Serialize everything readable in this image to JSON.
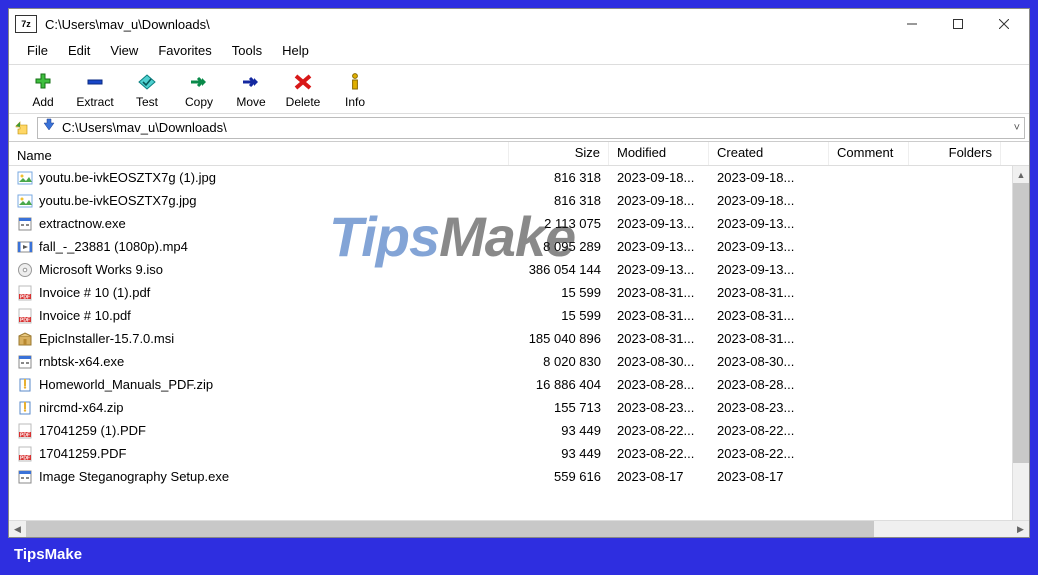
{
  "title": "C:\\Users\\mav_u\\Downloads\\",
  "app_icon_text": "7z",
  "menubar": [
    "File",
    "Edit",
    "View",
    "Favorites",
    "Tools",
    "Help"
  ],
  "toolbar": [
    {
      "id": "add",
      "label": "Add"
    },
    {
      "id": "extract",
      "label": "Extract"
    },
    {
      "id": "test",
      "label": "Test"
    },
    {
      "id": "copy",
      "label": "Copy"
    },
    {
      "id": "move",
      "label": "Move"
    },
    {
      "id": "delete",
      "label": "Delete"
    },
    {
      "id": "info",
      "label": "Info"
    }
  ],
  "path": "C:\\Users\\mav_u\\Downloads\\",
  "columns": {
    "name": "Name",
    "size": "Size",
    "modified": "Modified",
    "created": "Created",
    "comment": "Comment",
    "folders": "Folders"
  },
  "files": [
    {
      "icon": "img",
      "name": "youtu.be-ivkEOSZTX7g (1).jpg",
      "size": "816 318",
      "modified": "2023-09-18...",
      "created": "2023-09-18..."
    },
    {
      "icon": "img",
      "name": "youtu.be-ivkEOSZTX7g.jpg",
      "size": "816 318",
      "modified": "2023-09-18...",
      "created": "2023-09-18..."
    },
    {
      "icon": "exe",
      "name": "extractnow.exe",
      "size": "2 113 075",
      "modified": "2023-09-13...",
      "created": "2023-09-13..."
    },
    {
      "icon": "vid",
      "name": "fall_-_23881 (1080p).mp4",
      "size": "8 095 289",
      "modified": "2023-09-13...",
      "created": "2023-09-13..."
    },
    {
      "icon": "iso",
      "name": "Microsoft Works 9.iso",
      "size": "386 054 144",
      "modified": "2023-09-13...",
      "created": "2023-09-13..."
    },
    {
      "icon": "pdf",
      "name": "Invoice # 10 (1).pdf",
      "size": "15 599",
      "modified": "2023-08-31...",
      "created": "2023-08-31..."
    },
    {
      "icon": "pdf",
      "name": "Invoice # 10.pdf",
      "size": "15 599",
      "modified": "2023-08-31...",
      "created": "2023-08-31..."
    },
    {
      "icon": "msi",
      "name": "EpicInstaller-15.7.0.msi",
      "size": "185 040 896",
      "modified": "2023-08-31...",
      "created": "2023-08-31..."
    },
    {
      "icon": "exe",
      "name": "rnbtsk-x64.exe",
      "size": "8 020 830",
      "modified": "2023-08-30...",
      "created": "2023-08-30..."
    },
    {
      "icon": "zip",
      "name": "Homeworld_Manuals_PDF.zip",
      "size": "16 886 404",
      "modified": "2023-08-28...",
      "created": "2023-08-28..."
    },
    {
      "icon": "zip",
      "name": "nircmd-x64.zip",
      "size": "155 713",
      "modified": "2023-08-23...",
      "created": "2023-08-23..."
    },
    {
      "icon": "pdf",
      "name": "17041259 (1).PDF",
      "size": "93 449",
      "modified": "2023-08-22...",
      "created": "2023-08-22..."
    },
    {
      "icon": "pdf",
      "name": "17041259.PDF",
      "size": "93 449",
      "modified": "2023-08-22...",
      "created": "2023-08-22..."
    },
    {
      "icon": "exe",
      "name": "Image Steganography Setup.exe",
      "size": "559 616",
      "modified": "2023-08-17",
      "created": "2023-08-17"
    }
  ],
  "watermark": {
    "a": "Tips",
    "b": "Make"
  },
  "footer": "TipsMake"
}
